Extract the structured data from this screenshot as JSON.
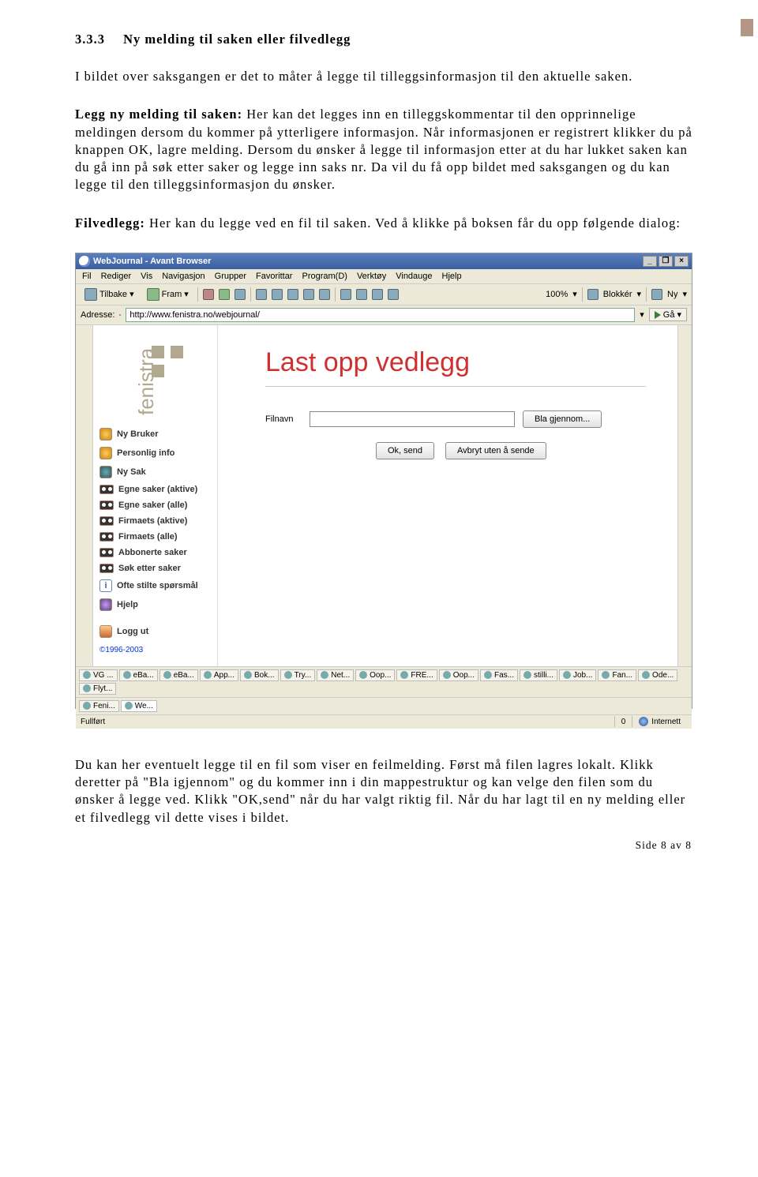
{
  "section": {
    "number": "3.3.3",
    "title": "Ny melding til saken eller filvedlegg"
  },
  "para1": "I bildet over saksgangen er det to måter å legge til tilleggsinformasjon til den aktuelle saken.",
  "para2_lead": "Legg ny melding til saken:",
  "para2": " Her kan det legges inn en tilleggskommentar til den opprinnelige meldingen dersom du kommer på ytterligere informasjon. Når informasjonen er registrert klikker du på knappen OK, lagre melding. Dersom du ønsker å legge til informasjon etter at du har lukket saken kan du gå inn på søk etter saker og legge inn saks nr. Da vil du få opp bildet med saksgangen og du kan legge til den tilleggsinformasjon du ønsker.",
  "para3_lead": "Filvedlegg:",
  "para3": " Her kan du legge ved en fil til saken. Ved å klikke på boksen får du opp følgende dialog:",
  "browser": {
    "title": "WebJournal - Avant Browser",
    "menu": [
      "Fil",
      "Rediger",
      "Vis",
      "Navigasjon",
      "Grupper",
      "Favorittar",
      "Program(D)",
      "Verktøy",
      "Vindauge",
      "Hjelp"
    ],
    "toolbar": {
      "back": "Tilbake",
      "fwd": "Fram",
      "zoom": "100%",
      "block": "Blokkér",
      "new": "Ny"
    },
    "address_label": "Adresse:",
    "address": "http://www.fenistra.no/webjournal/",
    "go": "Gå",
    "logo": "fenistra",
    "sidebar": [
      "Ny Bruker",
      "Personlig info",
      "Ny Sak",
      "Egne saker (aktive)",
      "Egne saker (alle)",
      "Firmaets (aktive)",
      "Firmaets (alle)",
      "Abbonerte saker",
      "Søk etter saker",
      "Ofte stilte spørsmål",
      "Hjelp",
      "Logg ut"
    ],
    "copyright": "©1996-2003",
    "main": {
      "title": "Last opp vedlegg",
      "filnavn": "Filnavn",
      "browse": "Bla gjennom...",
      "ok": "Ok, send",
      "cancel": "Avbryt uten å sende"
    },
    "tabs": [
      "VG ...",
      "eBa...",
      "eBa...",
      "App...",
      "Bok...",
      "Try...",
      "Net...",
      "Oop...",
      "FRE...",
      "Oop...",
      "Fas...",
      "stilli...",
      "Job...",
      "Fan...",
      "Ode...",
      "Flyt..."
    ],
    "tabs2": [
      "Feni...",
      "We..."
    ],
    "status_left": "Fullført",
    "status_num": "0",
    "status_net": "Internett"
  },
  "para4": "Du kan her eventuelt legge til en fil som viser en feilmelding. Først må filen lagres lokalt. Klikk deretter på \"Bla igjennom\" og du kommer inn i din mappestruktur og kan velge den filen som du ønsker å legge ved. Klikk \"OK,send\" når du har valgt riktig fil. Når du har lagt til en ny melding eller et filvedlegg vil dette vises i bildet.",
  "footer": "Side 8 av 8"
}
